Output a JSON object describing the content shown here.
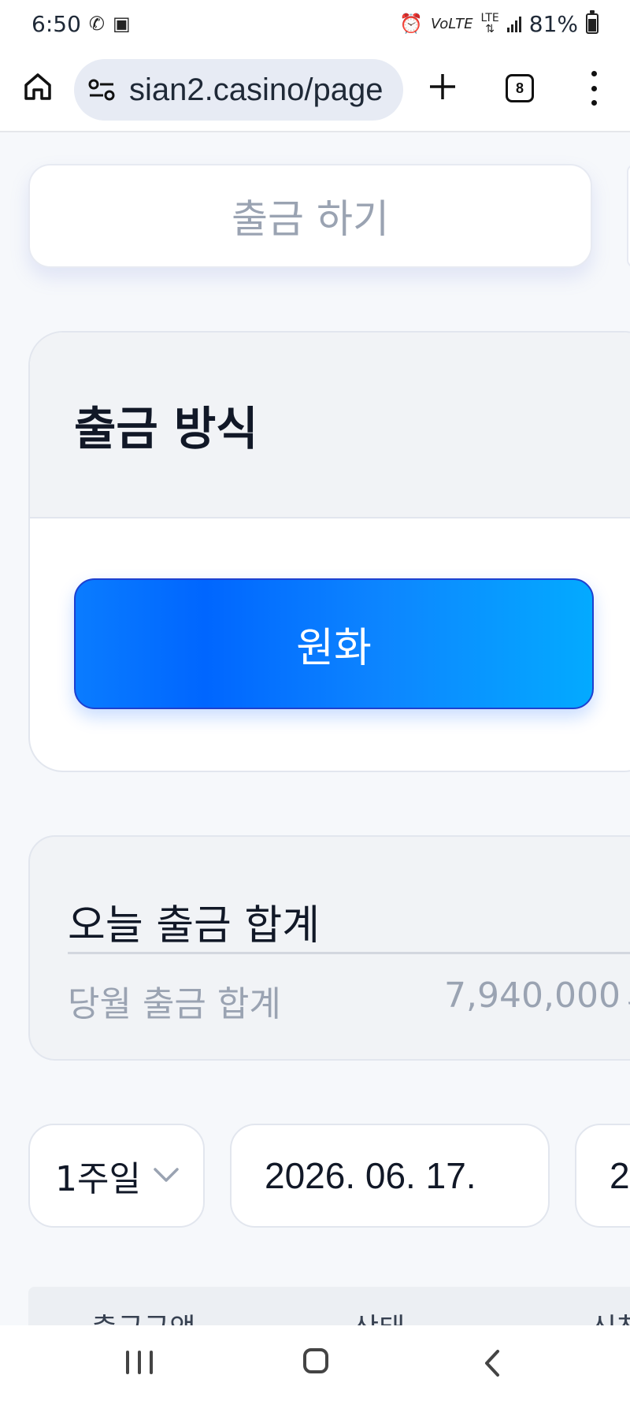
{
  "status_bar": {
    "time": "6:50",
    "battery": "81%",
    "network": "LTE"
  },
  "browser": {
    "url": "sian2.casino/page",
    "tab_count": "8"
  },
  "withdraw_button": {
    "label": "출금 하기"
  },
  "withdraw_method": {
    "title": "출금 방식",
    "options": [
      {
        "label": "원화",
        "selected": true
      }
    ]
  },
  "totals": {
    "today_title": "오늘 출금 합계",
    "month_label": "당월 출금 합계",
    "month_value": "7,940,000",
    "month_value_peek": "원"
  },
  "filters": {
    "period": "1주일",
    "start_date": "2026. 06. 17.",
    "end_date_peek": "2"
  },
  "table": {
    "headers": [
      "출금금액",
      "상태",
      "신청"
    ]
  },
  "colors": {
    "accent_start": "#0066ff",
    "accent_end": "#03aaff",
    "muted_text": "#9aa3b2"
  },
  "icons": {
    "home": "home-icon",
    "site_settings": "tune-icon",
    "new_tab": "plus-icon",
    "menu": "more-vert-icon",
    "chevron": "chevron-down-icon"
  }
}
